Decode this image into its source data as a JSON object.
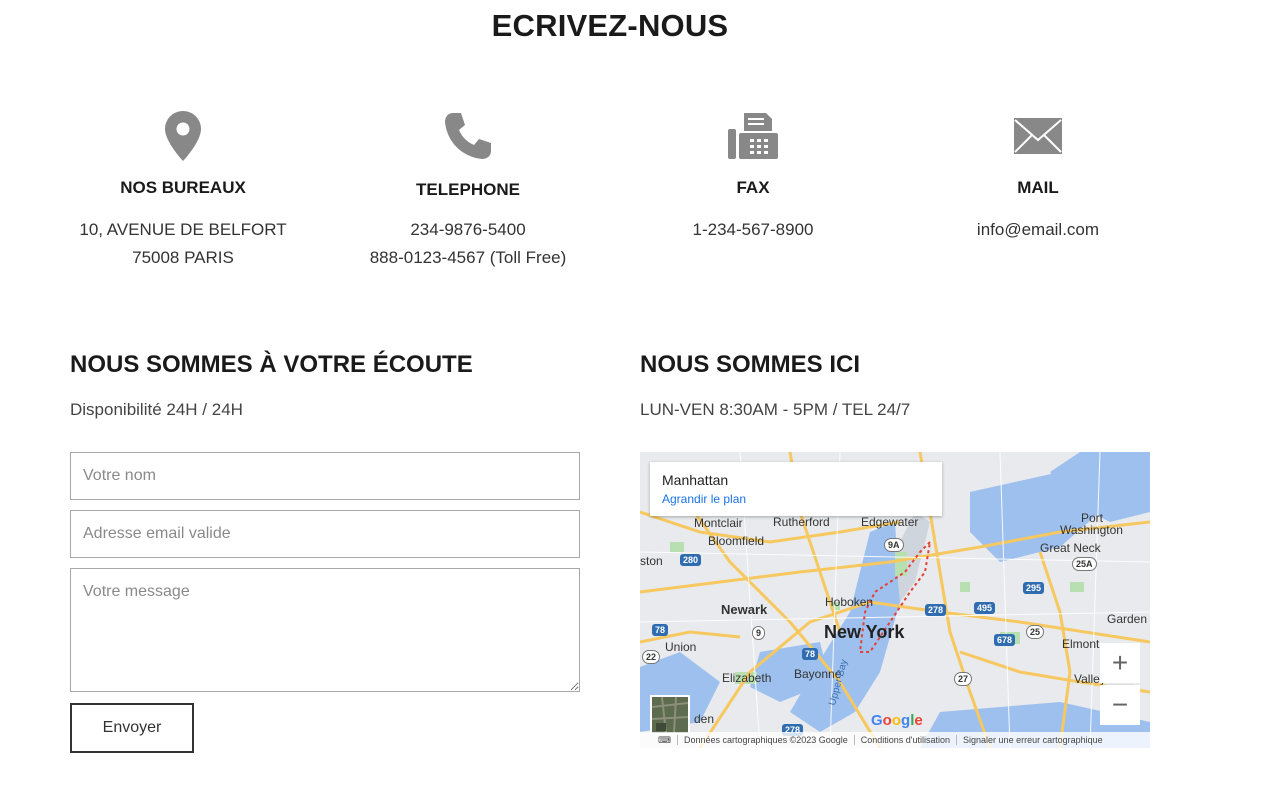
{
  "page_title": "ECRIVEZ-NOUS",
  "contacts": [
    {
      "icon": "location-pin-icon",
      "title": "NOS BUREAUX",
      "lines": [
        "10, AVENUE DE BELFORT",
        "75008 PARIS"
      ]
    },
    {
      "icon": "phone-icon",
      "title": "TELEPHONE",
      "lines": [
        "234-9876-5400",
        "888-0123-4567 (Toll Free)"
      ]
    },
    {
      "icon": "fax-icon",
      "title": "FAX",
      "lines": [
        "1-234-567-8900"
      ]
    },
    {
      "icon": "mail-icon",
      "title": "MAIL",
      "lines": [
        "info@email.com"
      ]
    }
  ],
  "form_section": {
    "heading": "NOUS SOMMES À VOTRE ÉCOUTE",
    "subtext": "Disponibilité 24H / 24H",
    "name_placeholder": "Votre nom",
    "name_value": "",
    "email_placeholder": "Adresse email valide",
    "email_value": "",
    "message_placeholder": "Votre message",
    "message_value": "",
    "submit_label": "Envoyer"
  },
  "map_section": {
    "heading": "NOUS SOMMES ICI",
    "subtext": "LUN-VEN 8:30AM - 5PM / TEL  24/7",
    "place_name": "Manhattan",
    "enlarge_link": "Agrandir le plan",
    "zoom_in": "+",
    "zoom_out": "−",
    "google_logo": "Google",
    "attribution": {
      "keyboard": "⌨",
      "data": "Données cartographiques ©2023 Google",
      "terms": "Conditions d'utilisation",
      "report": "Signaler une erreur cartographique"
    },
    "labels": {
      "new_york": "New York",
      "newark": "Newark",
      "hoboken": "Hoboken",
      "rutherford": "Rutherford",
      "edgewater": "Edgewater",
      "montclair": "Montclair",
      "bloomfield": "Bloomfield",
      "port_washington_1": "Port",
      "port_washington_2": "Washington",
      "great_neck": "Great Neck",
      "union": "Union",
      "elizabeth": "Elizabeth",
      "bayonne": "Bayonne",
      "elmont": "Elmont",
      "valley_stream": "Valley Stre",
      "garden_city": "Garden C",
      "ston": "ston",
      "linden": "den",
      "upper_bay": "Upper Bay"
    },
    "shields": [
      "280",
      "9A",
      "278",
      "495",
      "295",
      "25A",
      "78",
      "9",
      "678",
      "25",
      "22",
      "78",
      "27",
      "278"
    ],
    "colors": {
      "water": "#9ec0ee",
      "land": "#e8eaed",
      "park": "#b7dfb0",
      "highway": "#f6c85f"
    }
  }
}
